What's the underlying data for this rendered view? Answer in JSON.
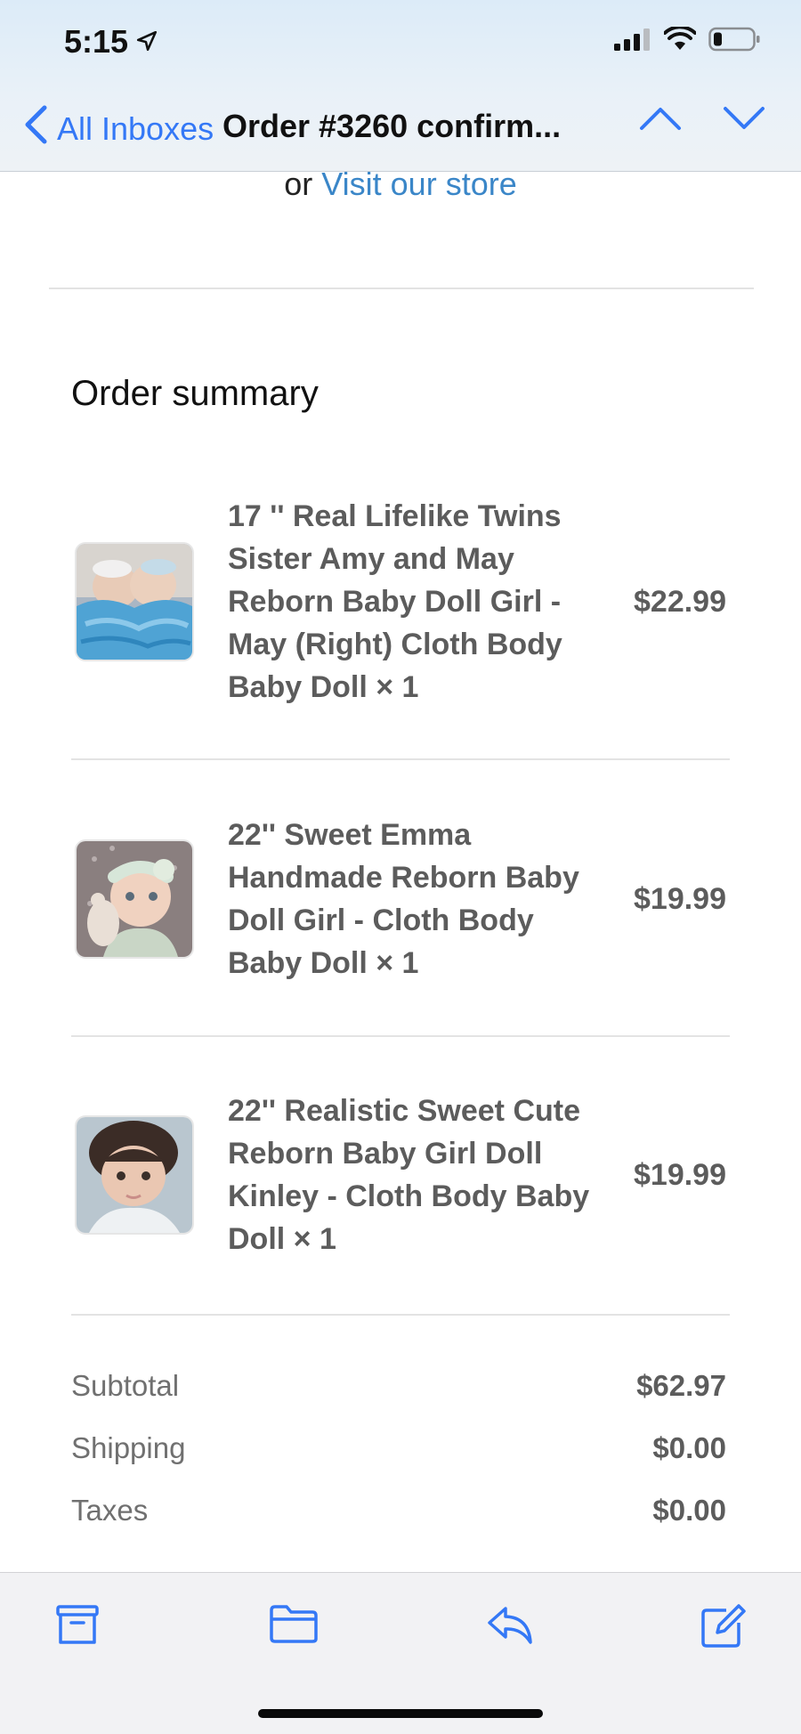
{
  "status": {
    "time": "5:15"
  },
  "nav": {
    "back_label": "All Inboxes",
    "title": "Order #3260 confirm..."
  },
  "store_link": {
    "prefix": "or",
    "label": "Visit our store"
  },
  "summary_title": "Order summary",
  "items": [
    {
      "name": "17 '' Real Lifelike Twins Sister Amy and May Reborn Baby Doll Girl - May (Right) Cloth Body Baby Doll × 1",
      "price": "$22.99"
    },
    {
      "name": "22'' Sweet Emma Handmade Reborn Baby Doll Girl - Cloth Body Baby Doll × 1",
      "price": "$19.99"
    },
    {
      "name": "22'' Realistic Sweet Cute Reborn Baby Girl Doll Kinley - Cloth Body Baby Doll × 1",
      "price": "$19.99"
    }
  ],
  "totals": [
    {
      "label": "Subtotal",
      "value": "$62.97"
    },
    {
      "label": "Shipping",
      "value": "$0.00"
    },
    {
      "label": "Taxes",
      "value": "$0.00"
    }
  ],
  "toolbar": {
    "icons": [
      "archive-icon",
      "folder-icon",
      "reply-icon",
      "compose-icon"
    ]
  },
  "colors": {
    "accent": "#3478f6",
    "link": "#3a86c8"
  }
}
